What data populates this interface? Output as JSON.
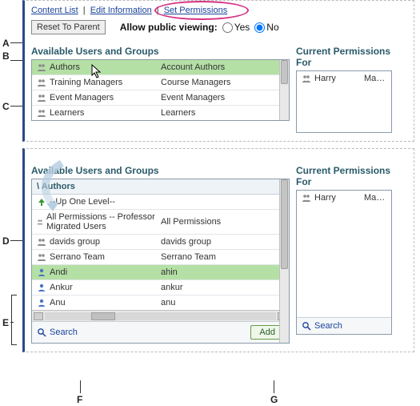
{
  "tabs": {
    "content_list": "Content List",
    "edit_info": "Edit Information",
    "set_perm": "Set Permissions"
  },
  "toolbar": {
    "reset_label": "Reset To Parent",
    "allow_label": "Allow public viewing:",
    "yes": "Yes",
    "no": "No"
  },
  "panel1": {
    "avail_title": "Available Users and Groups",
    "curr_title": "Current Permissions For",
    "rows": [
      {
        "name": "Authors",
        "desc": "Account Authors",
        "sel": true,
        "icon": "group"
      },
      {
        "name": "Training Managers",
        "desc": "Course Managers",
        "sel": false,
        "icon": "group"
      },
      {
        "name": "Event Managers",
        "desc": "Event Managers",
        "sel": false,
        "icon": "group"
      },
      {
        "name": "Learners",
        "desc": "Learners",
        "sel": false,
        "icon": "group"
      }
    ],
    "curr_rows": [
      {
        "name": "Harry",
        "role": "Manag"
      }
    ]
  },
  "panel2": {
    "avail_title": "Available Users and Groups",
    "curr_title": "Current Permissions For",
    "breadcrumb": "\\ Authors",
    "up_label": "--Up One Level--",
    "rows": [
      {
        "name": "All Permissions -- Professor Migrated Users",
        "desc": "All Permissions",
        "icon": "group"
      },
      {
        "name": "davids group",
        "desc": "davids group",
        "icon": "group"
      },
      {
        "name": "Serrano Team",
        "desc": "Serrano Team",
        "icon": "group"
      },
      {
        "name": "Andi",
        "desc": "ahin",
        "icon": "user",
        "sel": true
      },
      {
        "name": "Ankur",
        "desc": "ankur",
        "icon": "user"
      },
      {
        "name": "Anu",
        "desc": "anu",
        "icon": "user"
      }
    ],
    "curr_rows": [
      {
        "name": "Harry",
        "role": "Manag"
      }
    ],
    "search": "Search",
    "add": "Add"
  },
  "annotations": {
    "A": "A",
    "B": "B",
    "C": "C",
    "D": "D",
    "E": "E",
    "F": "F",
    "G": "G"
  }
}
